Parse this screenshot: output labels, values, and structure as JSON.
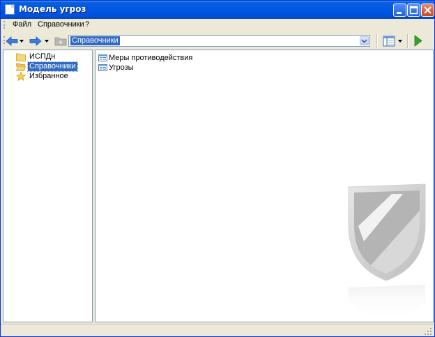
{
  "window": {
    "title": "Модель угроз"
  },
  "menu": {
    "items": [
      "Файл",
      "Справочники",
      "?"
    ]
  },
  "toolbar": {
    "address_value": "Справочники"
  },
  "tree": {
    "items": [
      {
        "label": "ИСПДн",
        "icon": "folder-icon"
      },
      {
        "label": "Справочники",
        "icon": "folder-open-icon",
        "selected": true
      },
      {
        "label": "Избранное",
        "icon": "star-icon"
      }
    ]
  },
  "list": {
    "items": [
      {
        "label": "Меры противодействия",
        "icon": "list-item-icon"
      },
      {
        "label": "Угрозы",
        "icon": "list-item-icon"
      }
    ]
  },
  "colors": {
    "titlebar": "#0058e6",
    "selection": "#316ac5",
    "back_arrow": "#3b7ee0",
    "forward_arrow": "#3b7ee0",
    "run_button": "#2fa52f"
  }
}
